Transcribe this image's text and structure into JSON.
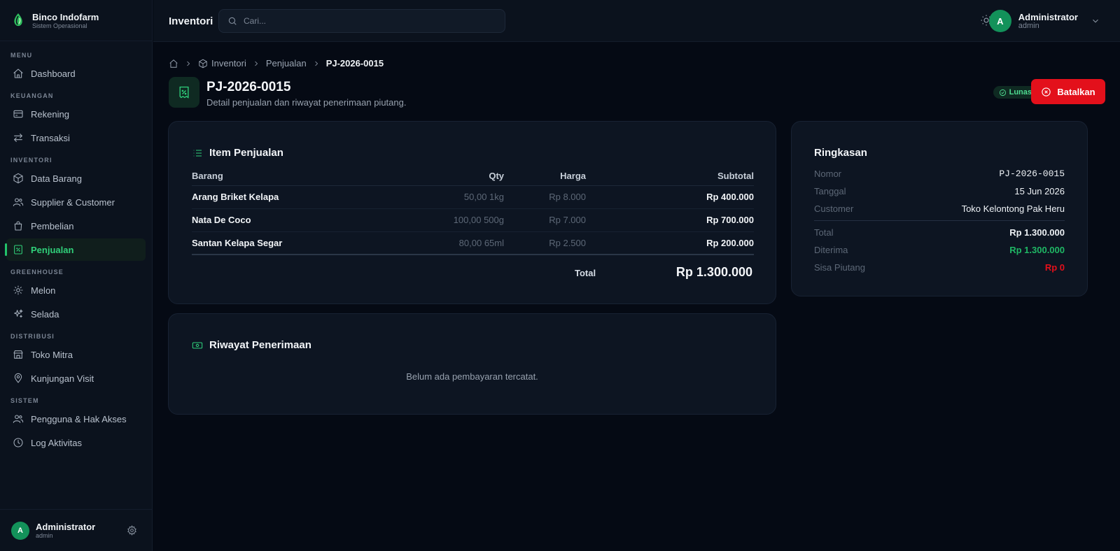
{
  "brand": {
    "name": "Binco Indofarm",
    "subtitle": "Sistem Operasional"
  },
  "sidebar": {
    "sections": {
      "menu": "MENU",
      "keuangan": "KEUANGAN",
      "inventori": "INVENTORI",
      "greenhouse": "GREENHOUSE",
      "distribusi": "DISTRIBUSI",
      "sistem": "SISTEM"
    },
    "items": {
      "dashboard": "Dashboard",
      "rekening": "Rekening",
      "transaksi": "Transaksi",
      "data_barang": "Data Barang",
      "supplier_customer": "Supplier & Customer",
      "pembelian": "Pembelian",
      "penjualan": "Penjualan",
      "melon": "Melon",
      "selada": "Selada",
      "toko_mitra": "Toko Mitra",
      "kunjungan_visit": "Kunjungan Visit",
      "pengguna": "Pengguna & Hak Akses",
      "log_aktivitas": "Log Aktivitas"
    },
    "active": "penjualan",
    "footer_user": {
      "initial": "A",
      "name": "Administrator",
      "role": "admin"
    }
  },
  "topbar": {
    "title": "Inventori",
    "search_placeholder": "Cari...",
    "user": {
      "initial": "A",
      "name": "Administrator",
      "role": "admin"
    }
  },
  "breadcrumb": {
    "inventori": "Inventori",
    "penjualan": "Penjualan",
    "current": "PJ-2026-0015"
  },
  "header": {
    "title": "PJ-2026-0015",
    "subtitle": "Detail penjualan dan riwayat penerimaan piutang.",
    "status": "Lunas",
    "cancel_label": "Batalkan"
  },
  "items_card": {
    "title": "Item Penjualan",
    "columns": {
      "barang": "Barang",
      "qty": "Qty",
      "harga": "Harga",
      "subtotal": "Subtotal"
    },
    "rows": [
      {
        "name": "Arang Briket Kelapa",
        "qty": "50,00 1kg",
        "price": "Rp 8.000",
        "subtotal": "Rp 400.000"
      },
      {
        "name": "Nata De Coco",
        "qty": "100,00 500g",
        "price": "Rp 7.000",
        "subtotal": "Rp 700.000"
      },
      {
        "name": "Santan Kelapa Segar",
        "qty": "80,00 65ml",
        "price": "Rp 2.500",
        "subtotal": "Rp 200.000"
      }
    ],
    "total_label": "Total",
    "total_value": "Rp 1.300.000"
  },
  "receipts_card": {
    "title": "Riwayat Penerimaan",
    "empty": "Belum ada pembayaran tercatat."
  },
  "summary_card": {
    "title": "Ringkasan",
    "nomor_label": "Nomor",
    "nomor": "PJ-2026-0015",
    "tanggal_label": "Tanggal",
    "tanggal": "15 Jun 2026",
    "customer_label": "Customer",
    "customer": "Toko Kelontong Pak Heru",
    "total_label": "Total",
    "total": "Rp 1.300.000",
    "diterima_label": "Diterima",
    "diterima": "Rp 1.300.000",
    "sisa_label": "Sisa Piutang",
    "sisa": "Rp 0"
  },
  "colors": {
    "accent": "#22c36b",
    "danger": "#e3101b",
    "background": "#050a14",
    "panel": "#0d1522"
  }
}
